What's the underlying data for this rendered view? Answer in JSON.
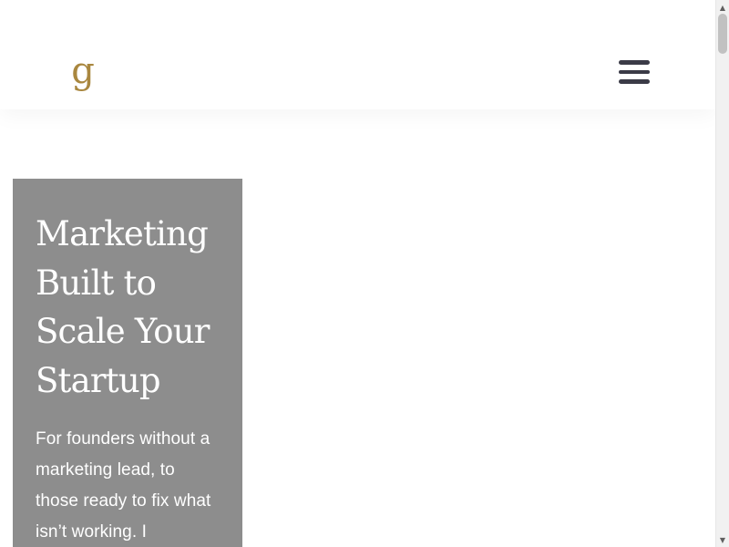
{
  "header": {
    "logo_text": "g",
    "menu_icon": "hamburger-menu-icon"
  },
  "hero": {
    "title": "Marketing Built to Scale Your Startup",
    "text": "For founders without a marketing lead, to those ready to fix what isn’t working. I"
  },
  "scrollbar": {
    "up_icon": "scroll-up-arrow-icon",
    "down_icon": "scroll-down-arrow-icon",
    "up_glyph": "▲",
    "down_glyph": "▼"
  },
  "colors": {
    "background": "#ffffff",
    "logo_gold": "#a9873f",
    "menu_icon": "#3b3b47",
    "hero_card": "#8d8d8d",
    "hero_text": "#ffffff",
    "scrollbar_track": "#f1f1f1",
    "scrollbar_thumb": "#c1c1c1"
  }
}
